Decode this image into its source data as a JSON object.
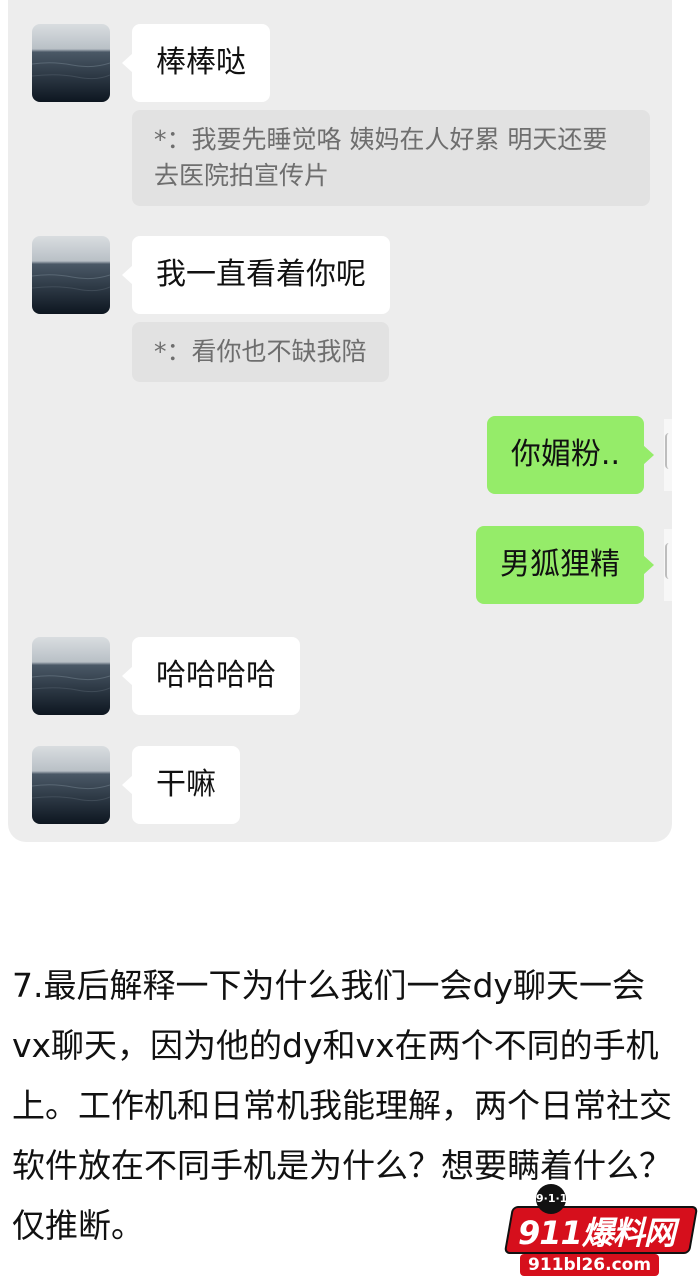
{
  "chat": {
    "messages": [
      {
        "side": "received",
        "text": "棒棒哒"
      },
      {
        "side": "quote",
        "text": "*：我要先睡觉咯 姨妈在人好累 明天还要去医院拍宣传片"
      },
      {
        "side": "received",
        "text": "我一直看着你呢"
      },
      {
        "side": "quote",
        "text": "*：看你也不缺我陪"
      },
      {
        "side": "sent",
        "text": "你媚粉.."
      },
      {
        "side": "sent",
        "text": "男狐狸精"
      },
      {
        "side": "received",
        "text": "哈哈哈哈"
      },
      {
        "side": "received",
        "text": "干嘛"
      }
    ]
  },
  "article": {
    "paragraph": "7.最后解释一下为什么我们一会dy聊天一会vx聊天，因为他的dy和vx在两个不同的手机上。工作机和日常机我能理解，两个日常社交软件放在不同手机是为什么？想要瞒着什么？仅推断。"
  },
  "watermark": {
    "badge": "9·1·1",
    "title": "911爆料网",
    "url": "911bl26.com"
  },
  "colors": {
    "panel_bg": "#ededed",
    "received_bubble": "#ffffff",
    "sent_bubble": "#95ec69",
    "quote_bg": "#e2e2e2",
    "brand_red": "#d60f1c"
  },
  "icons": {
    "avatar": "sea-landscape-avatar"
  }
}
